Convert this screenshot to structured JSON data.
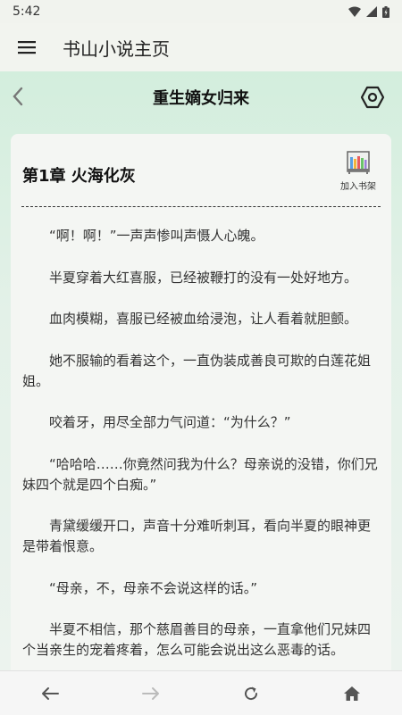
{
  "status_bar": {
    "time": "5:42"
  },
  "app_bar": {
    "title": "书山小说主页"
  },
  "reader": {
    "book_title": "重生嫡女归来",
    "chapter_title": "第1章 火海化灰",
    "bookshelf_label": "加入书架",
    "paragraphs": [
      "“啊！啊！”一声声惨叫声慑人心魄。",
      "半夏穿着大红喜服，已经被鞭打的没有一处好地方。",
      "血肉模糊，喜服已经被血给浸泡，让人看着就胆颤。",
      "她不服输的看着这个，一直伪装成善良可欺的白莲花姐姐。",
      "咬着牙，用尽全部力气问道：“为什么？”",
      "“哈哈哈……你竟然问我为什么？母亲说的没错，你们兄妹四个就是四个白痴。”",
      "青黛缓缓开口，声音十分难听刺耳，看向半夏的眼神更是带着恨意。",
      "“母亲，不，母亲不会说这样的话。”",
      "半夏不相信，那个慈眉善目的母亲，一直拿他们兄妹四个当亲生的宠着疼着，怎么可能会说出这么恶毒的话。"
    ]
  },
  "icons": {
    "menu": "hamburger-menu-icon",
    "back": "chevron-left-icon",
    "settings": "hexagon-settings-icon",
    "bookshelf": "bookshelf-icon",
    "nav_back": "arrow-left-icon",
    "nav_forward": "arrow-right-icon",
    "nav_refresh": "refresh-icon",
    "nav_home": "home-icon"
  }
}
